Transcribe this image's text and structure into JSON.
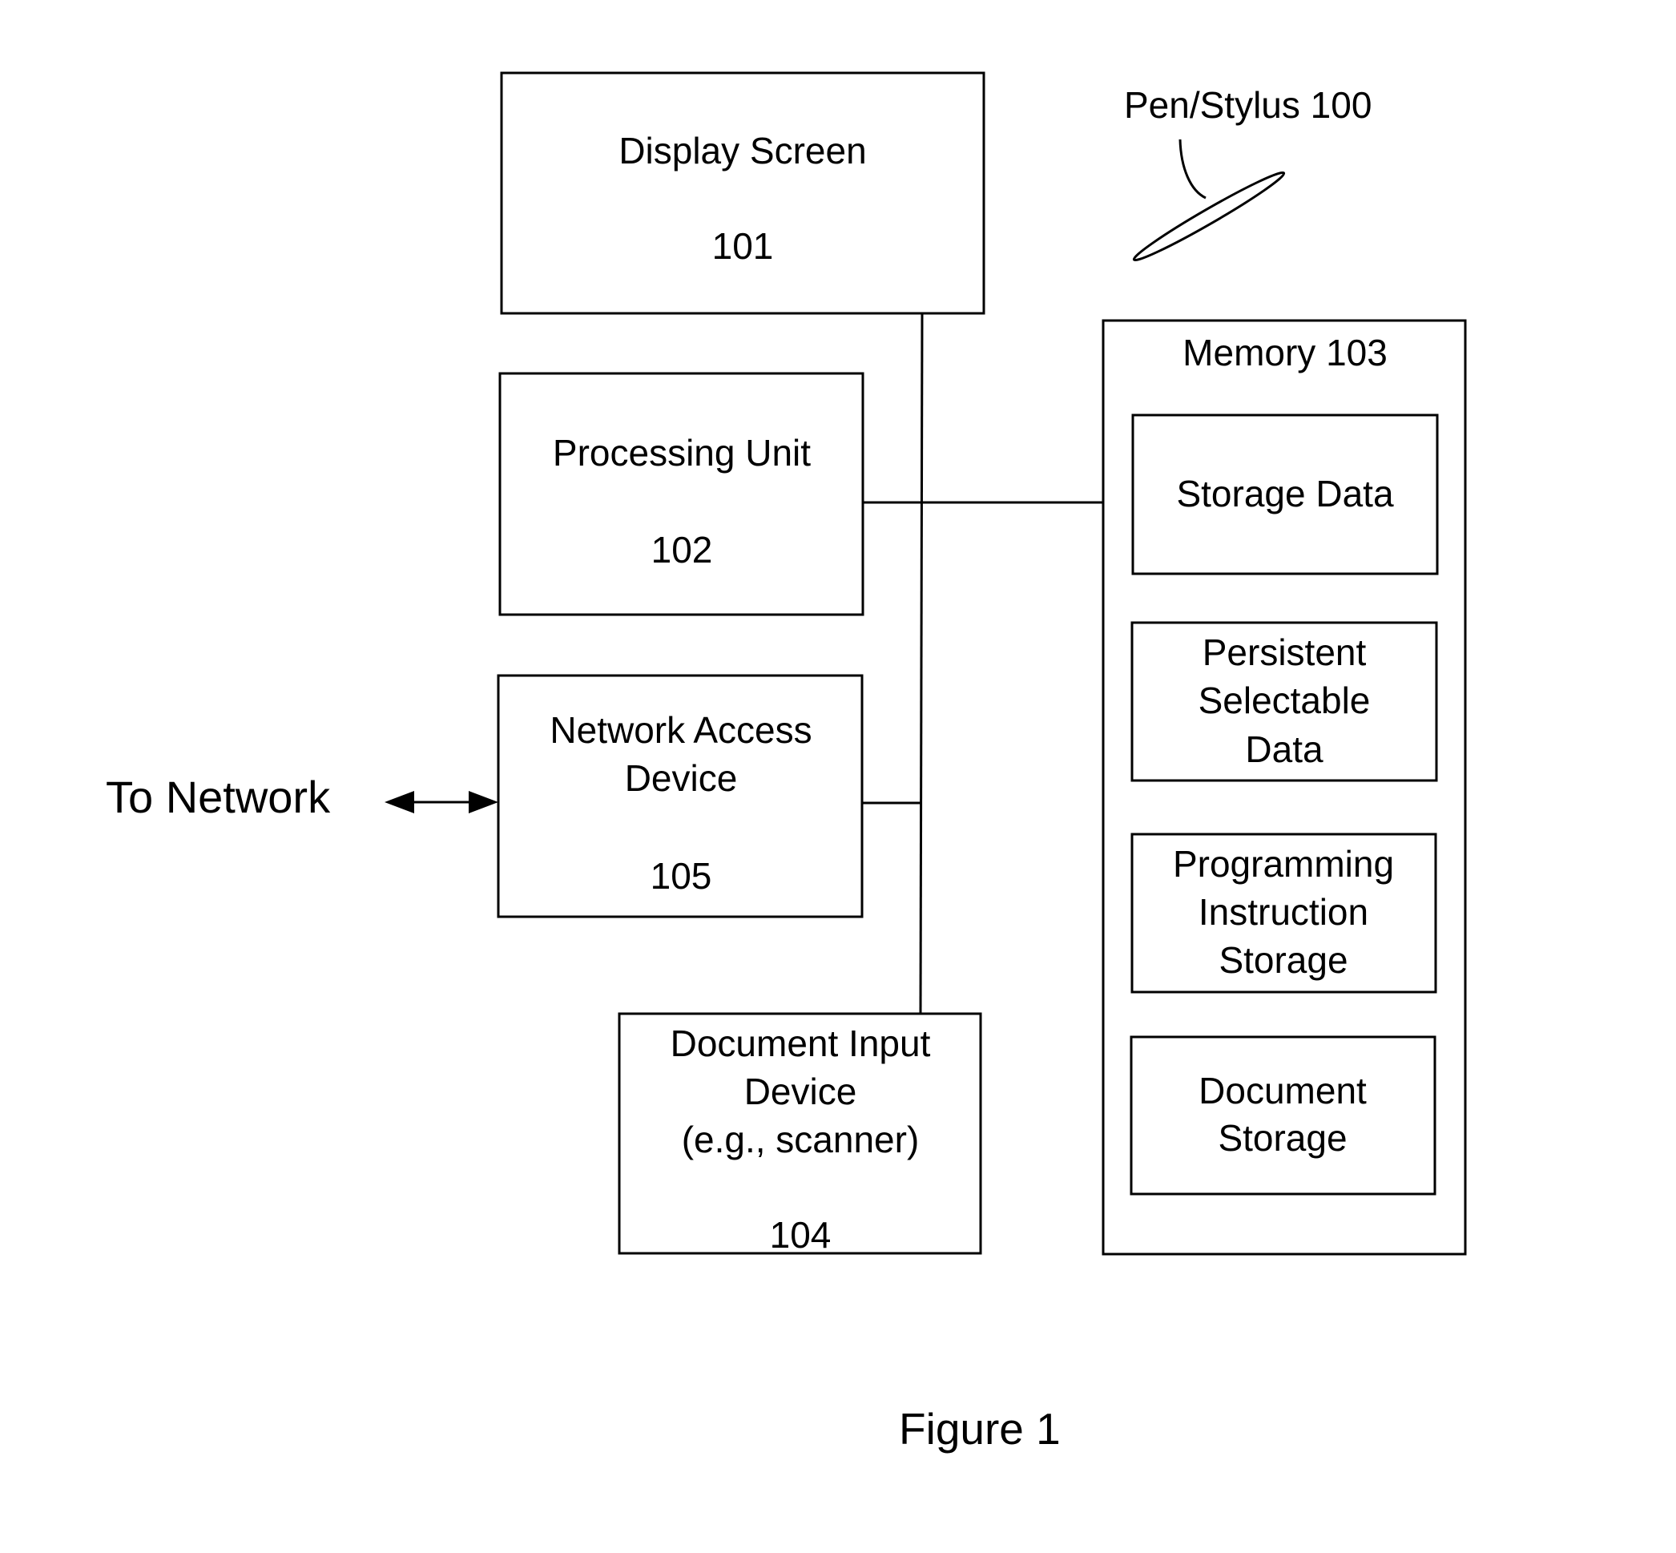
{
  "figure": {
    "caption": "Figure 1",
    "stylus_label": "Pen/Stylus 100",
    "network_label": "To Network"
  },
  "components": {
    "display": {
      "lines": [
        "Display Screen"
      ],
      "ref": "101"
    },
    "processing": {
      "lines": [
        "Processing Unit"
      ],
      "ref": "102"
    },
    "network": {
      "lines": [
        "Network Access",
        "Device"
      ],
      "ref": "105"
    },
    "doc_input": {
      "lines": [
        "Document Input",
        "Device",
        "(e.g., scanner)"
      ],
      "ref": "104"
    },
    "memory": {
      "title": "Memory 103"
    }
  },
  "memory_items": [
    {
      "lines": [
        "Storage Data"
      ]
    },
    {
      "lines": [
        "Persistent",
        "Selectable",
        "Data"
      ]
    },
    {
      "lines": [
        "Programming",
        "Instruction",
        "Storage"
      ]
    },
    {
      "lines": [
        "Document",
        "Storage"
      ]
    }
  ],
  "colors": {
    "stroke": "#000000",
    "background": "#ffffff"
  }
}
